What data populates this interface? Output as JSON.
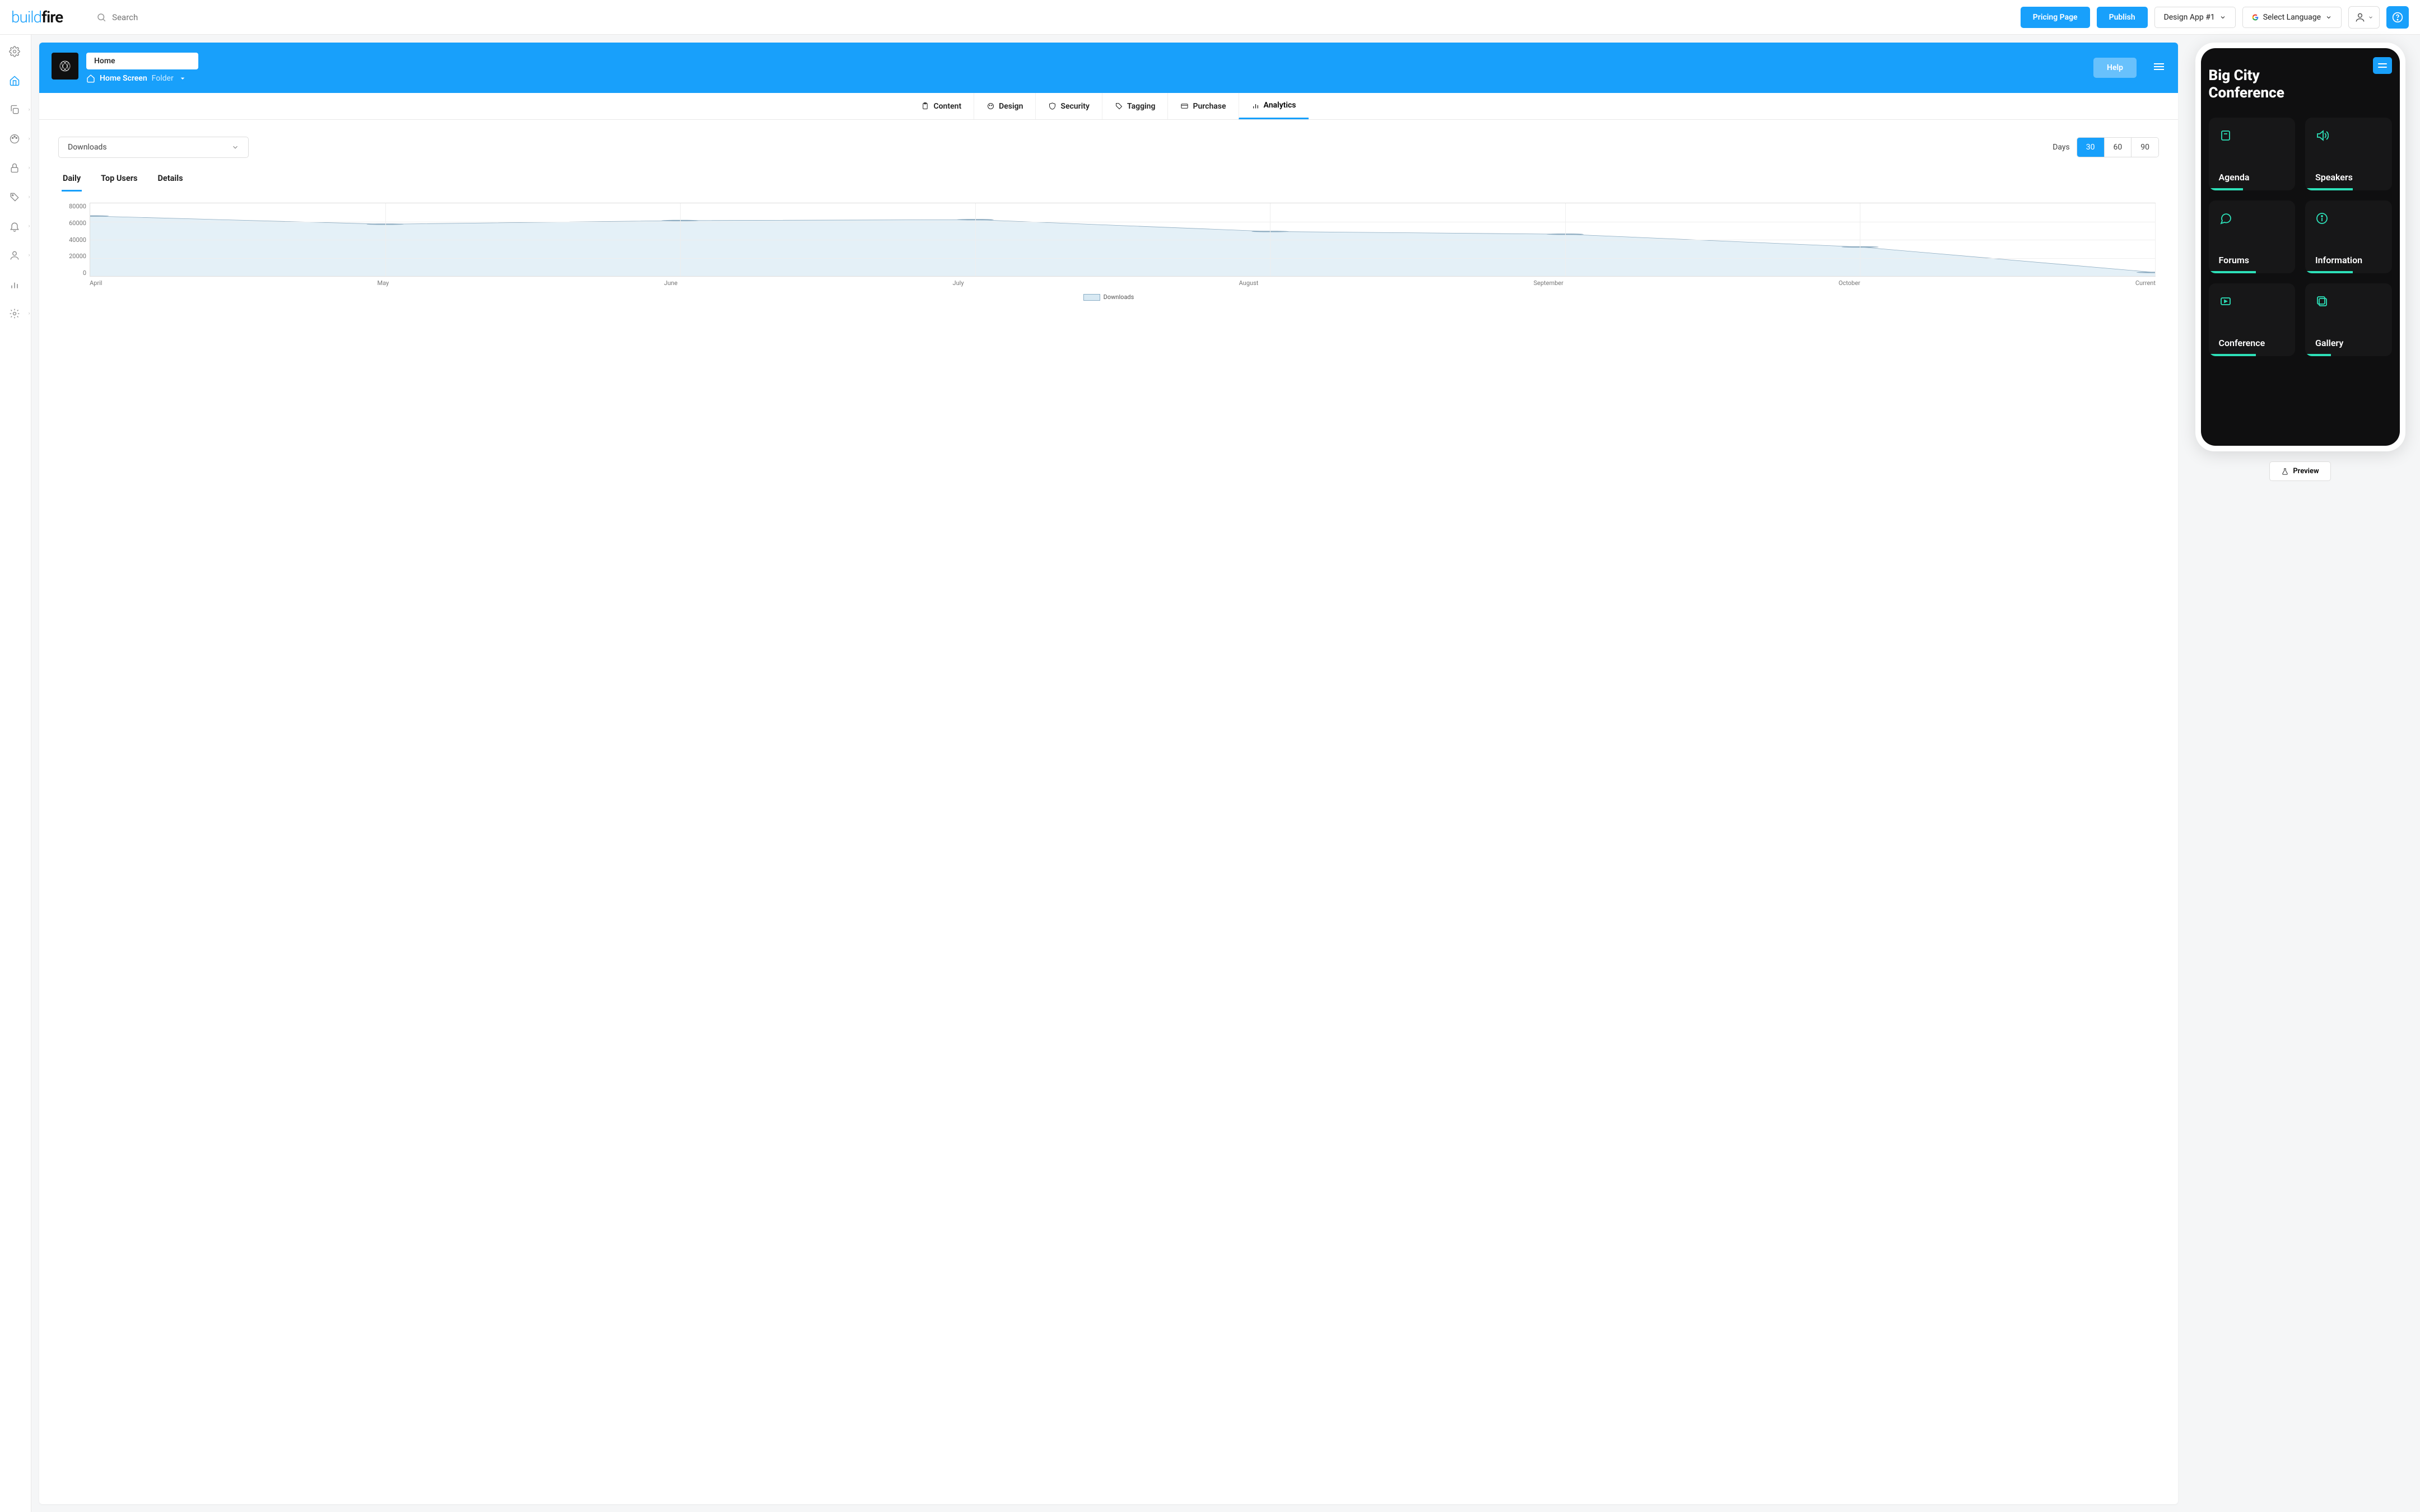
{
  "topbar": {
    "logo_part1": "build",
    "logo_part2": "fire",
    "search_placeholder": "Search",
    "pricing_label": "Pricing Page",
    "publish_label": "Publish",
    "design_app_label": "Design App #1",
    "select_language_label": "Select Language"
  },
  "header": {
    "home_input_value": "Home",
    "breadcrumb_primary": "Home Screen",
    "breadcrumb_secondary": "Folder",
    "help_label": "Help"
  },
  "tabs": {
    "content": "Content",
    "design": "Design",
    "security": "Security",
    "tagging": "Tagging",
    "purchase": "Purchase",
    "analytics": "Analytics"
  },
  "controls": {
    "metric_dropdown_label": "Downloads",
    "days_label": "Days",
    "opt_30": "30",
    "opt_60": "60",
    "opt_90": "90"
  },
  "subtabs": {
    "daily": "Daily",
    "top_users": "Top Users",
    "details": "Details"
  },
  "chart_data": {
    "type": "area",
    "title": "",
    "xlabel": "",
    "ylabel": "",
    "ylim": [
      0,
      80000
    ],
    "y_ticks": [
      "80000",
      "60000",
      "40000",
      "20000",
      "0"
    ],
    "categories": [
      "April",
      "May",
      "June",
      "July",
      "August",
      "September",
      "October",
      "Current"
    ],
    "series": [
      {
        "name": "Downloads",
        "values": [
          66000,
          57000,
          61000,
          62000,
          49000,
          46000,
          32000,
          4000
        ]
      }
    ],
    "legend_label": "Downloads"
  },
  "preview": {
    "app_title_line1": "Big City",
    "app_title_line2": "Conference",
    "tiles": {
      "agenda": "Agenda",
      "speakers": "Speakers",
      "forums": "Forums",
      "information": "Information",
      "conference": "Conference",
      "gallery": "Gallery"
    },
    "preview_btn": "Preview"
  }
}
